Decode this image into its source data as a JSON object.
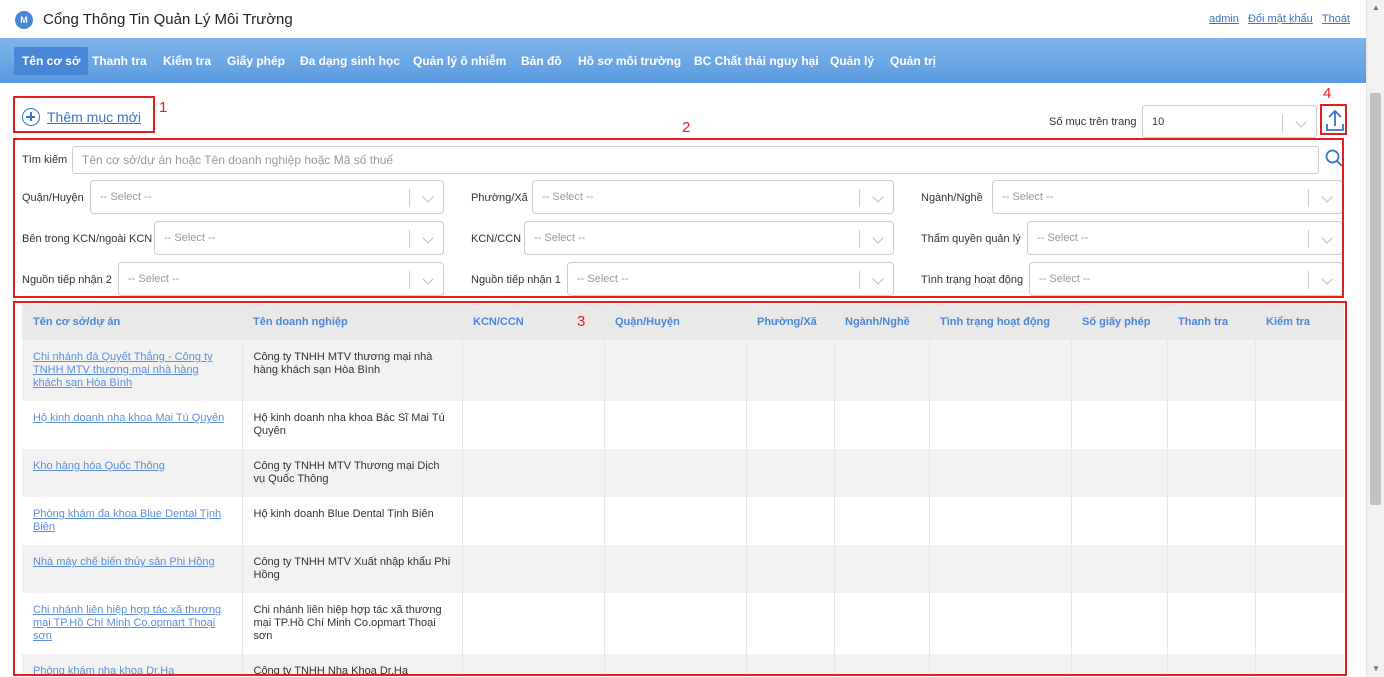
{
  "header": {
    "logo_text": "M",
    "title": "Cổng Thông Tin Quản Lý Môi Trường",
    "user_links": [
      "admin",
      "Đổi mật khẩu",
      "Thoát"
    ]
  },
  "nav": {
    "items": [
      "Tên cơ sở",
      "Thanh tra",
      "Kiểm tra",
      "Giấy phép",
      "Đa dạng sinh học",
      "Quản lý ô nhiễm",
      "Bản đồ",
      "Hồ sơ môi trường",
      "BC Chất thải nguy hại",
      "Quản lý",
      "Quản trị"
    ],
    "active_index": 0
  },
  "annotations": [
    "1",
    "2",
    "3",
    "4"
  ],
  "toolbar": {
    "add_new_label": "Thêm mục mới",
    "per_page_label": "Số mục trên trang",
    "per_page_value": "10"
  },
  "filters": {
    "search_label": "Tìm kiếm",
    "search_placeholder": "Tên cơ sở/dự án hoặc Tên doanh nghiệp hoặc Mã số thuế",
    "district_label": "Quận/Huyện",
    "ward_label": "Phường/Xã",
    "industry_label": "Ngành/Nghề",
    "inside_kcn_label": "Bên trong KCN/ngoài KCN",
    "kcn_label": "KCN/CCN",
    "authority_label": "Thẩm quyền quản lý",
    "source2_label": "Nguồn tiếp nhận 2",
    "source1_label": "Nguồn tiếp nhận 1",
    "status_label": "Tình trạng hoạt động",
    "select_placeholder": "-- Select --"
  },
  "table": {
    "columns": [
      "Tên cơ sở/dự án",
      "Tên doanh nghiệp",
      "KCN/CCN",
      "Quận/Huyện",
      "Phường/Xã",
      "Ngành/Nghề",
      "Tình trạng hoạt động",
      "Số giấy phép",
      "Thanh tra",
      "Kiểm tra"
    ],
    "rows": [
      {
        "project": "Chi nhánh đá Quyết Thắng - Công ty TNHH MTV thương mại nhà hàng khách sạn Hòa Bình",
        "company": "Công ty TNHH MTV thương mại nhà hàng khách sạn Hòa Bình"
      },
      {
        "project": "Hộ kinh doanh nha khoa Mai Tú Quyên",
        "company": "Hộ kinh doanh nha khoa Bác Sĩ Mai Tú Quyên"
      },
      {
        "project": "Kho hàng hóa Quốc Thông",
        "company": "Công ty TNHH MTV Thương mại Dịch vụ Quốc Thông"
      },
      {
        "project": "Phòng khám đa khoa Blue Dental Tịnh Biên",
        "company": "Hộ kinh doanh Blue Dental Tịnh Biên"
      },
      {
        "project": "Nhà máy chế biến thủy sản Phi Hồng",
        "company": "Công ty TNHH MTV Xuất nhập khẩu Phi Hồng"
      },
      {
        "project": "Chi nhánh liên hiệp hợp tác xã thương mại TP.Hồ Chí Minh Co.opmart Thoại sơn",
        "company": "Chi nhánh liên hiệp hợp tác xã thương mại TP.Hồ Chí Minh Co.opmart Thoại sơn"
      },
      {
        "project": "Phòng khám nha khoa Dr.Ha",
        "company": "Công ty TNHH Nha Khoa Dr.Ha"
      }
    ]
  }
}
